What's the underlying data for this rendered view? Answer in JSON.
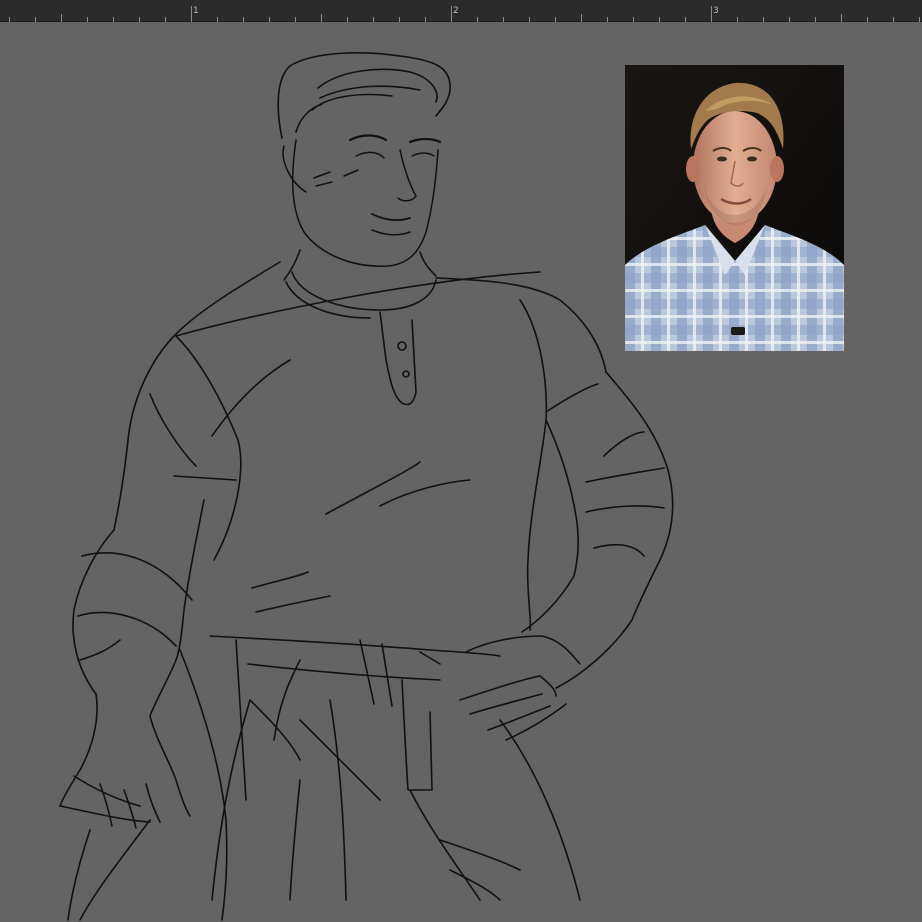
{
  "ruler": {
    "labels": [
      "1",
      "2",
      "3"
    ],
    "background": "#2b2b2b",
    "tick_color": "#8a8a8a"
  },
  "canvas": {
    "background": "#646464",
    "stroke_color": "#111111"
  },
  "reference_photo": {
    "icon": "portrait-photo",
    "background": "#0e0c0b",
    "shirt_color": "#9fb3cf"
  }
}
